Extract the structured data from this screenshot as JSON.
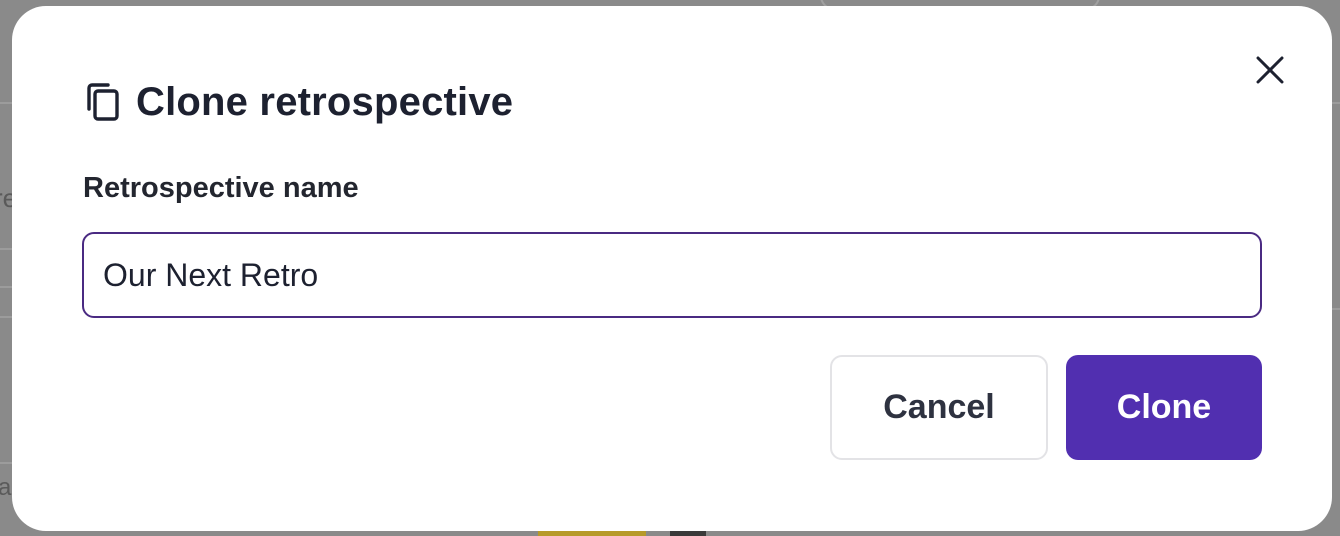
{
  "dialog": {
    "title": "Clone retrospective",
    "title_icon": "copy-icon",
    "close_icon": "close-icon",
    "field_label": "Retrospective name",
    "name_value": "Our Next Retro",
    "cancel_label": "Cancel",
    "clone_label": "Clone"
  },
  "background": {
    "fragment_left": "re",
    "fragment_bottom": "a"
  },
  "colors": {
    "primary": "#512fb0",
    "input_border": "#4a2a82",
    "text": "#1d2130",
    "overlay": "#8a8a8a"
  }
}
